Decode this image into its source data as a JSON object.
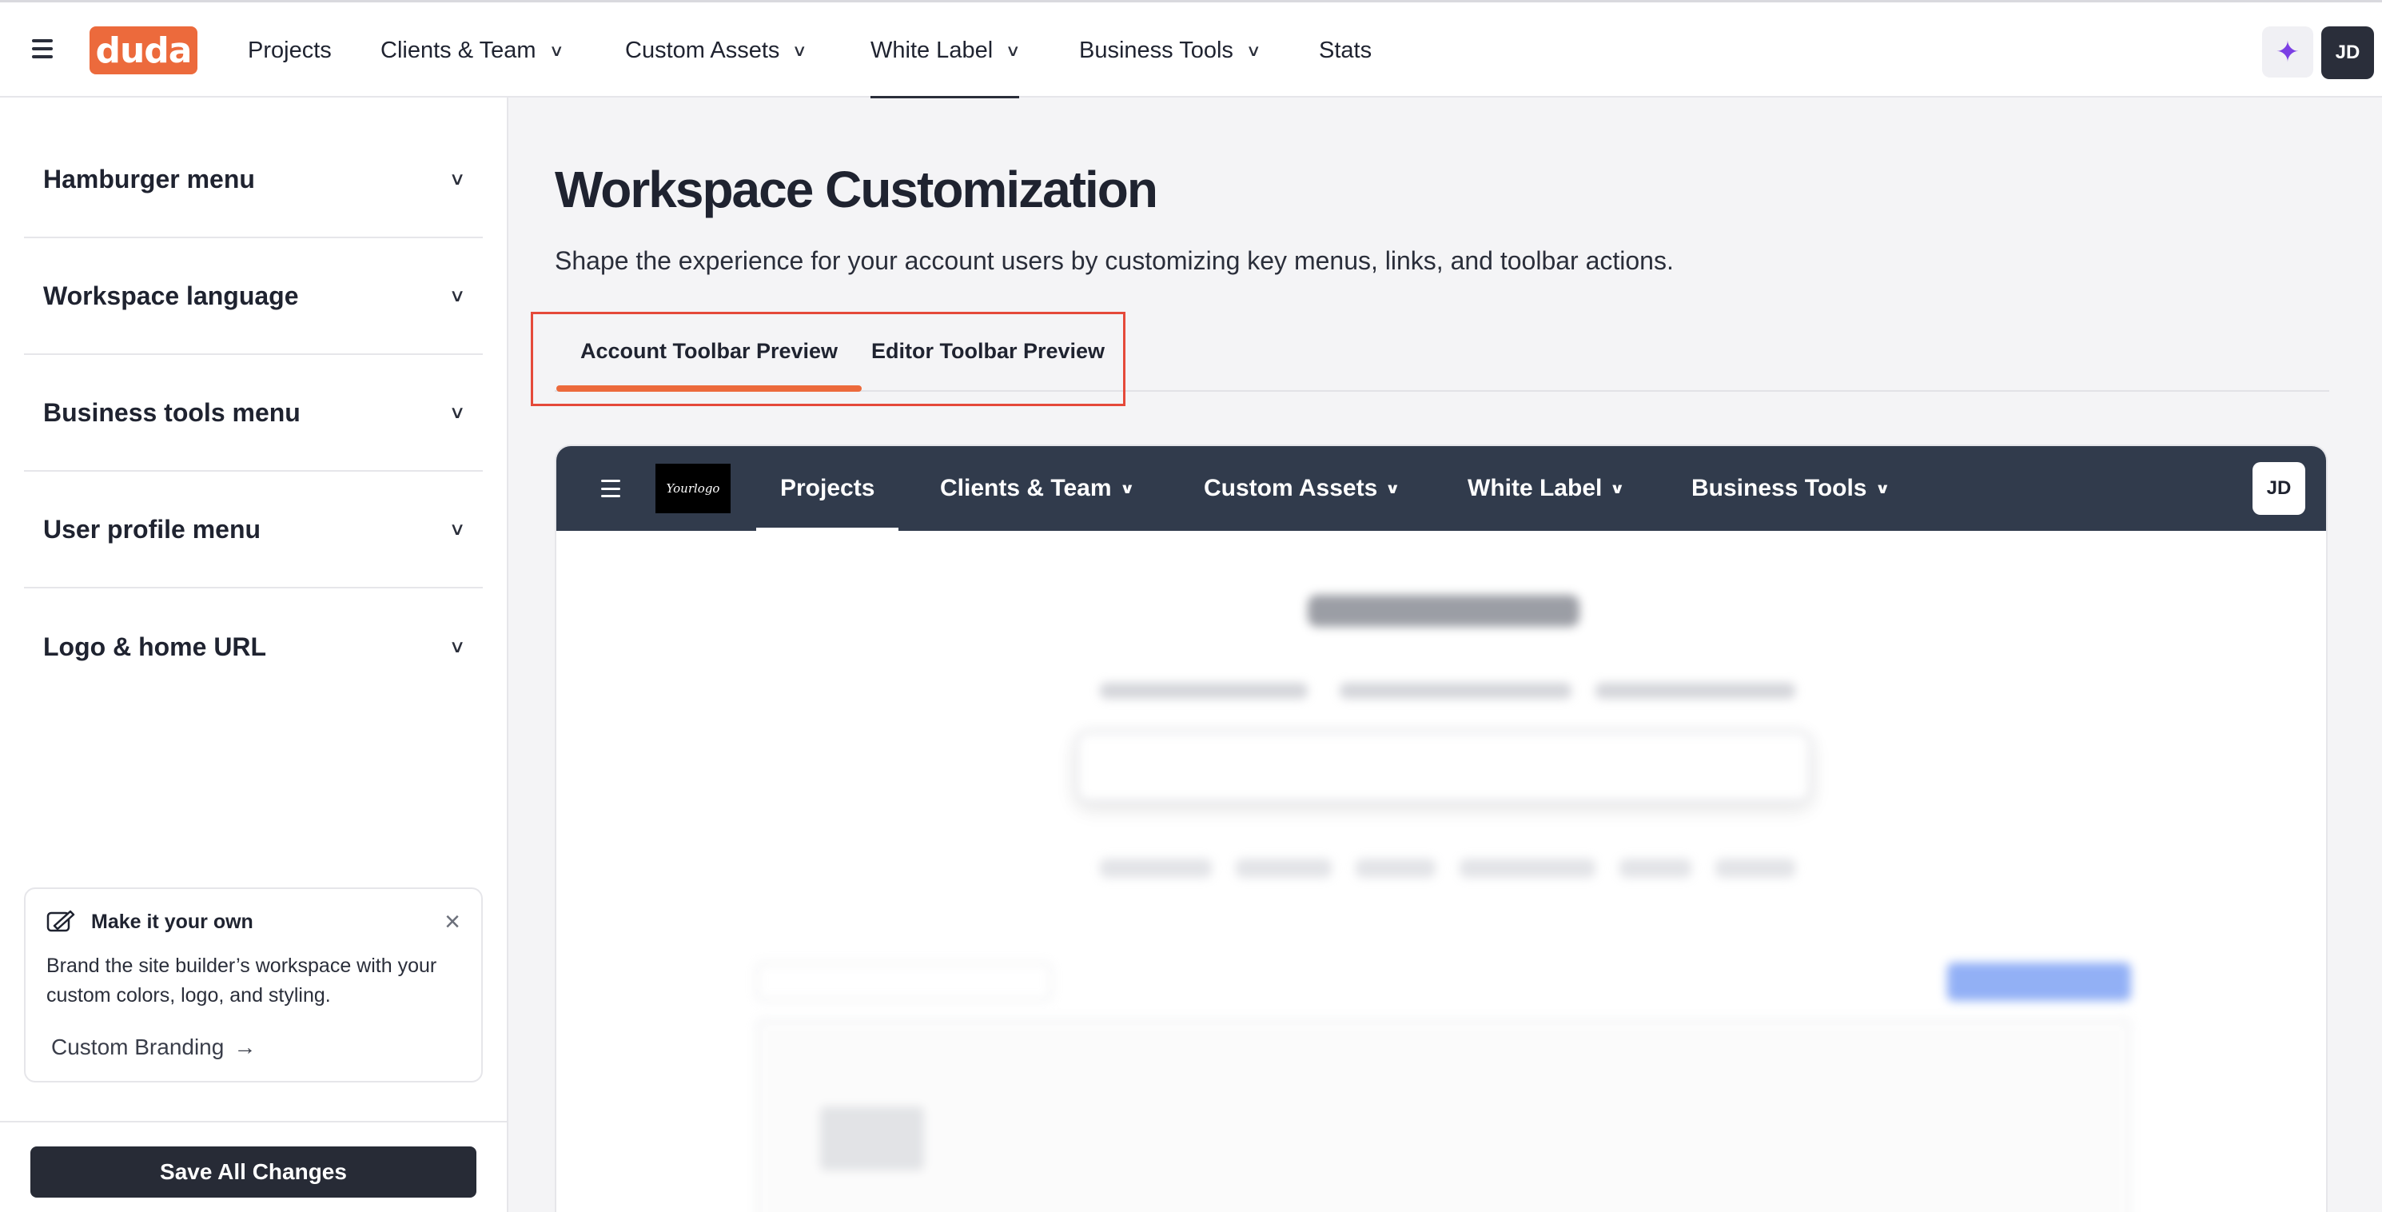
{
  "topnav": {
    "logo": "duda",
    "items": [
      {
        "label": "Projects",
        "dropdown": false
      },
      {
        "label": "Clients & Team",
        "dropdown": true
      },
      {
        "label": "Custom Assets",
        "dropdown": true
      },
      {
        "label": "White Label",
        "dropdown": true,
        "active": true
      },
      {
        "label": "Business Tools",
        "dropdown": true
      },
      {
        "label": "Stats",
        "dropdown": false
      }
    ],
    "avatar": "JD"
  },
  "sidebar": {
    "items": [
      {
        "label": "Hamburger menu"
      },
      {
        "label": "Workspace language"
      },
      {
        "label": "Business tools menu"
      },
      {
        "label": "User profile menu"
      },
      {
        "label": "Logo & home URL"
      }
    ],
    "promo": {
      "title": "Make it your own",
      "body": "Brand the site builder’s workspace with your custom colors, logo, and styling.",
      "link": "Custom Branding"
    },
    "save_label": "Save All Changes"
  },
  "main": {
    "title": "Workspace Customization",
    "subtitle": "Shape the experience for your account users by customizing key menus, links, and toolbar actions.",
    "tabs": [
      {
        "label": "Account Toolbar Preview",
        "active": true
      },
      {
        "label": "Editor Toolbar Preview",
        "active": false
      }
    ]
  },
  "preview": {
    "logo_text": "Yourlogo",
    "items": [
      {
        "label": "Projects",
        "active": true
      },
      {
        "label": "Clients & Team"
      },
      {
        "label": "Custom Assets"
      },
      {
        "label": "White Label"
      },
      {
        "label": "Business Tools"
      }
    ],
    "avatar": "JD"
  },
  "colors": {
    "brand": "#ec6a3c",
    "toolbar_bg": "#313b4c",
    "highlight": "#e5493a",
    "dark_button": "#272b36"
  }
}
